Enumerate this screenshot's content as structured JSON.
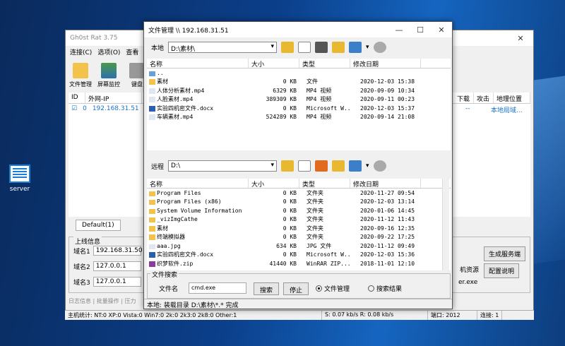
{
  "desktop": {
    "icon_label": "server"
  },
  "gh": {
    "title": "Gh0st Rat 3.75",
    "menu": [
      "连接(C)",
      "选项(O)",
      "查看"
    ],
    "tools": [
      "文件管理",
      "屏幕监控",
      "键盘"
    ],
    "cols": [
      "ID",
      "外网-IP"
    ],
    "right_cols": [
      "下载",
      "攻击",
      "地理位置"
    ],
    "row": {
      "id": "0",
      "ip": "192.168.31.51",
      "c1": "--",
      "c2": "--",
      "loc": "本地局域..."
    },
    "tab": "Default(1)",
    "online": {
      "title": "上线信息",
      "labels": [
        "域名1",
        "域名2",
        "域名3"
      ],
      "values": [
        "192.168.31.50",
        "127.0.0.1",
        "127.0.0.1"
      ]
    },
    "btn_gen": "生成服务端",
    "btn_cfg": "配置说明",
    "res_label": "机资源",
    "exe_label": "er.exe",
    "log": "日志信息 | 批量操作 | 压力"
  },
  "status": {
    "stats": "主机统计: NT:0  XP:0  Vista:0  Win7:0  2k:0  2k3:0  2k8:0  Other:1",
    "speed": "S: 0.07 kb/s  R: 0.08 kb/s",
    "port": "端口: 2012",
    "conn": "连接: 1"
  },
  "fm": {
    "title": "文件管理 \\\\ 192.168.31.51",
    "local_label": "本地",
    "local_path": "D:\\素材\\",
    "remote_label": "远程",
    "remote_path": "D:\\",
    "headers": [
      "名称",
      "大小",
      "类型",
      "修改日期"
    ],
    "local_files": [
      {
        "name": "..",
        "size": "",
        "type": "",
        "date": "",
        "icon": "up"
      },
      {
        "name": "素材",
        "size": "0 KB",
        "type": "文件",
        "date": "2020-12-03 15:38",
        "icon": "folder"
      },
      {
        "name": "人体分析素材.mp4",
        "size": "6329 KB",
        "type": "MP4 视频",
        "date": "2020-09-09 10:34",
        "icon": "file"
      },
      {
        "name": "人脸素材.mp4",
        "size": "389309 KB",
        "type": "MP4 视频",
        "date": "2020-09-11 00:23",
        "icon": "file"
      },
      {
        "name": "实验四机密文件.docx",
        "size": "0 KB",
        "type": "Microsoft W...",
        "date": "2020-12-03 15:37",
        "icon": "doc"
      },
      {
        "name": "车辆素材.mp4",
        "size": "524289 KB",
        "type": "MP4 视频",
        "date": "2020-09-14 21:08",
        "icon": "file"
      }
    ],
    "remote_files": [
      {
        "name": "Program Files",
        "size": "0 KB",
        "type": "文件夹",
        "date": "2020-11-27 09:54",
        "icon": "folder"
      },
      {
        "name": "Program Files (x86)",
        "size": "0 KB",
        "type": "文件夹",
        "date": "2020-12-03 13:14",
        "icon": "folder"
      },
      {
        "name": "System Volume Information",
        "size": "0 KB",
        "type": "文件夹",
        "date": "2020-01-06 14:45",
        "icon": "folder"
      },
      {
        "name": "_vizImgCathe",
        "size": "0 KB",
        "type": "文件夹",
        "date": "2020-11-12 11:43",
        "icon": "folder"
      },
      {
        "name": "素材",
        "size": "0 KB",
        "type": "文件夹",
        "date": "2020-09-16 12:35",
        "icon": "folder"
      },
      {
        "name": "终端模拟器",
        "size": "0 KB",
        "type": "文件夹",
        "date": "2020-09-22 17:25",
        "icon": "folder"
      },
      {
        "name": "aaa.jpg",
        "size": "634 KB",
        "type": "JPG 文件",
        "date": "2020-11-12 09:49",
        "icon": "file"
      },
      {
        "name": "实验四机密文件.docx",
        "size": "0 KB",
        "type": "Microsoft W...",
        "date": "2020-12-03 15:36",
        "icon": "doc"
      },
      {
        "name": "织梦软件.zip",
        "size": "41440 KB",
        "type": "WinRAR ZIP...",
        "date": "2018-11-01 12:10",
        "icon": "zip"
      }
    ],
    "search": {
      "title": "文件搜索",
      "name_label": "文件名",
      "name_value": "cmd.exe",
      "search_btn": "搜索",
      "stop_btn": "停止",
      "radio1": "文件管理",
      "radio2": "搜索结果"
    },
    "status": "本地: 装载目录 D:\\素材\\*.* 完成"
  }
}
